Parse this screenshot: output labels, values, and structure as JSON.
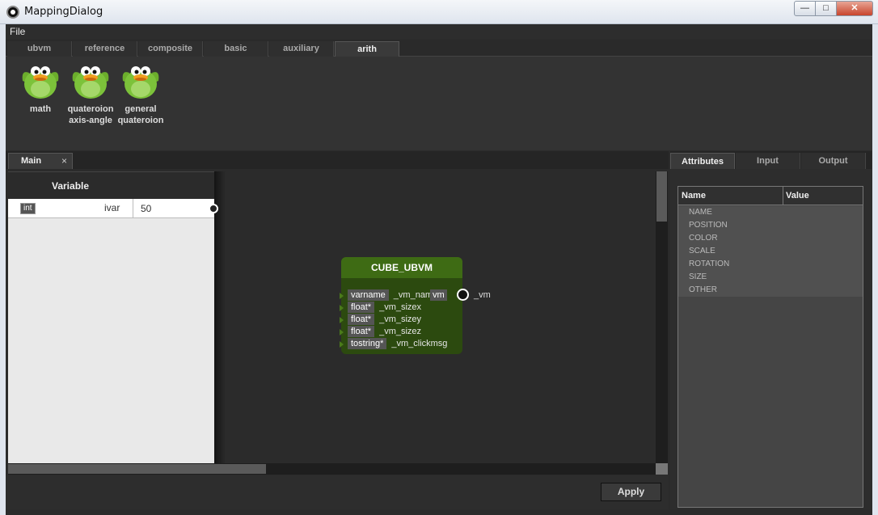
{
  "window": {
    "title": "MappingDialog",
    "minimize": "—",
    "maximize": "□",
    "close": "✕"
  },
  "menu": {
    "file": "File"
  },
  "palette_tabs": [
    "ubvm",
    "reference",
    "composite",
    "basic",
    "auxiliary",
    "arith"
  ],
  "palette_active_tab": "arith",
  "palette_items": [
    {
      "label_line1": "math",
      "label_line2": ""
    },
    {
      "label_line1": "quateroion",
      "label_line2": "axis-angle"
    },
    {
      "label_line1": "general",
      "label_line2": "quateroion"
    }
  ],
  "main_tab": {
    "label": "Main",
    "close": "×"
  },
  "variables": {
    "header": "Variable",
    "rows": [
      {
        "type": "int",
        "name": "ivar",
        "value": "50"
      }
    ]
  },
  "node": {
    "title": "CUBE_UBVM",
    "inputs": [
      {
        "type": "varname",
        "name": "_vm_nam"
      },
      {
        "type": "float*",
        "name": "_vm_sizex"
      },
      {
        "type": "float*",
        "name": "_vm_sizey"
      },
      {
        "type": "float*",
        "name": "_vm_sizez"
      },
      {
        "type": "tostring*",
        "name": "_vm_clickmsg"
      }
    ],
    "output_type": "vm",
    "output_name": "_vm",
    "colors": {
      "header": "#3e6b14",
      "body": "#2c4a0f"
    }
  },
  "apply_label": "Apply",
  "attr_tabs": [
    "Attributes",
    "Input",
    "Output"
  ],
  "attr_active_tab": "Attributes",
  "attributes": {
    "col_name": "Name",
    "col_value": "Value",
    "rows": [
      "NAME",
      "POSITION",
      "COLOR",
      "SCALE",
      "ROTATION",
      "SIZE",
      "OTHER"
    ]
  }
}
